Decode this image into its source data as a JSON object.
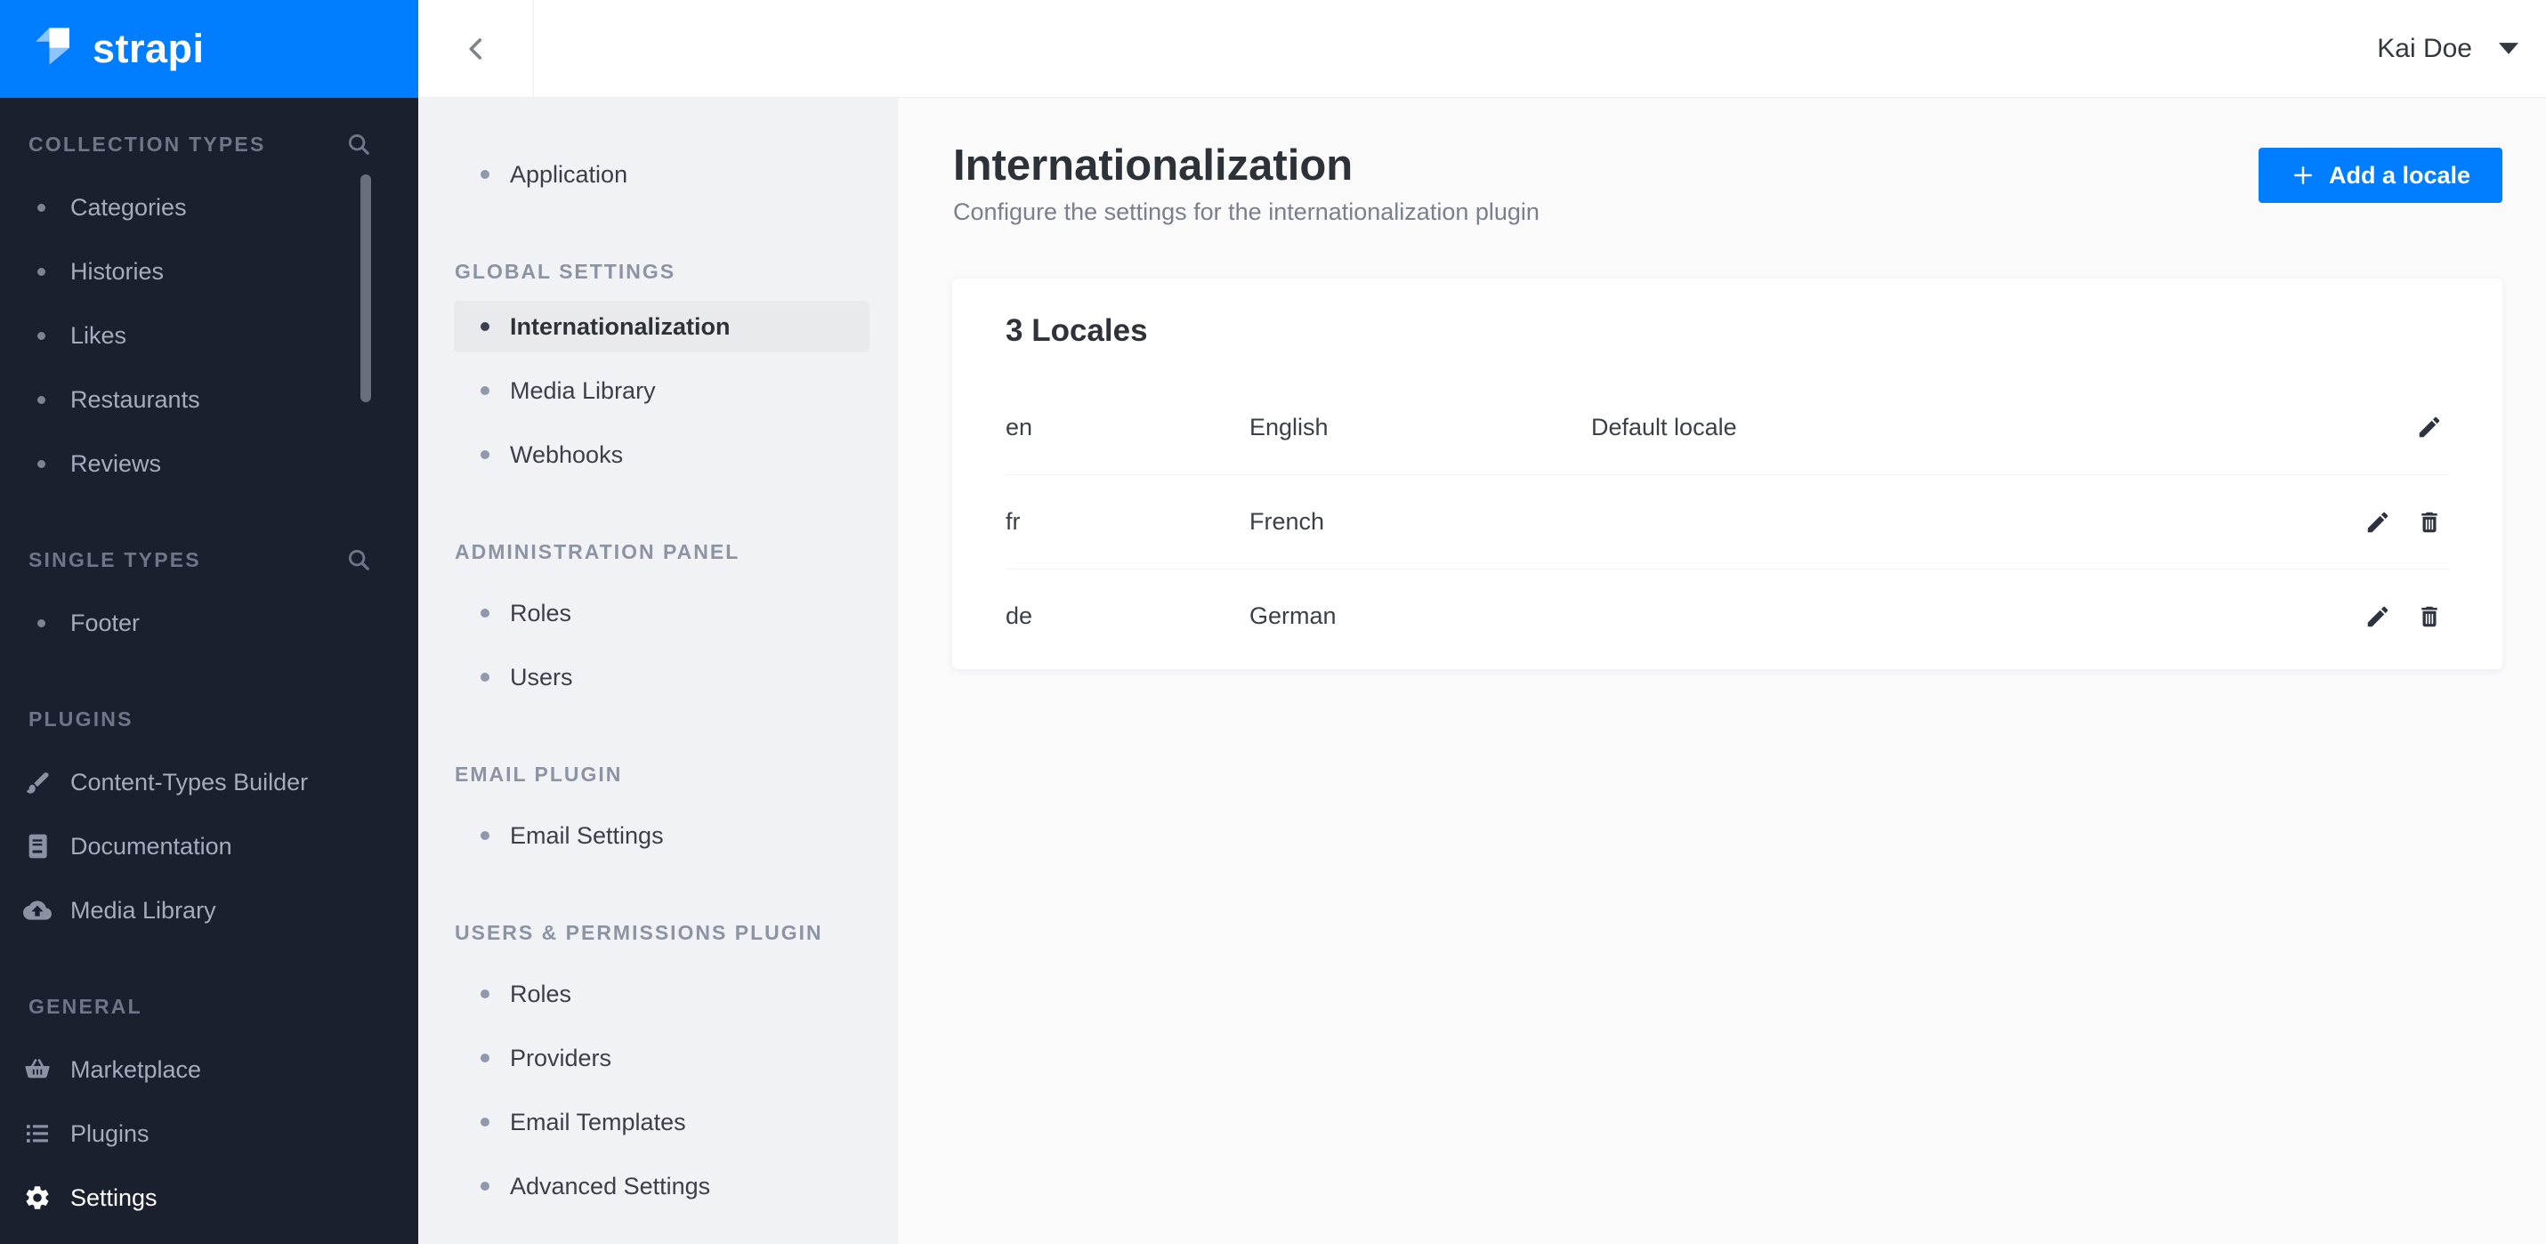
{
  "brand": {
    "name": "strapi",
    "accent_blue": "#007EFF",
    "sidebar_bg": "#1A202E"
  },
  "header": {
    "user_name": "Kai Doe",
    "back_icon": "chevron-left-icon",
    "user_caret_icon": "caret-down-icon"
  },
  "dark_sidebar": {
    "sections": [
      {
        "label": "COLLECTION TYPES",
        "search_icon": "search-icon",
        "items": [
          {
            "label": "Categories"
          },
          {
            "label": "Histories"
          },
          {
            "label": "Likes"
          },
          {
            "label": "Restaurants"
          },
          {
            "label": "Reviews"
          }
        ]
      },
      {
        "label": "SINGLE TYPES",
        "search_icon": "search-icon",
        "items": [
          {
            "label": "Footer"
          }
        ]
      },
      {
        "label": "PLUGINS",
        "items": [
          {
            "label": "Content-Types Builder",
            "icon": "brush-icon"
          },
          {
            "label": "Documentation",
            "icon": "book-icon"
          },
          {
            "label": "Media Library",
            "icon": "cloud-upload-icon"
          }
        ]
      },
      {
        "label": "GENERAL",
        "items": [
          {
            "label": "Marketplace",
            "icon": "basket-icon"
          },
          {
            "label": "Plugins",
            "icon": "list-icon"
          },
          {
            "label": "Settings",
            "icon": "gear-icon",
            "active": true
          }
        ]
      }
    ]
  },
  "settings_sidebar": {
    "application": {
      "label": "Application"
    },
    "sections": [
      {
        "label": "GLOBAL SETTINGS",
        "items": [
          {
            "label": "Internationalization",
            "active": true
          },
          {
            "label": "Media Library"
          },
          {
            "label": "Webhooks"
          }
        ]
      },
      {
        "label": "ADMINISTRATION PANEL",
        "items": [
          {
            "label": "Roles"
          },
          {
            "label": "Users"
          }
        ]
      },
      {
        "label": "EMAIL PLUGIN",
        "items": [
          {
            "label": "Email Settings"
          }
        ]
      },
      {
        "label": "USERS & PERMISSIONS PLUGIN",
        "items": [
          {
            "label": "Roles"
          },
          {
            "label": "Providers"
          },
          {
            "label": "Email Templates"
          },
          {
            "label": "Advanced Settings"
          }
        ]
      }
    ]
  },
  "main": {
    "title": "Internationalization",
    "subtitle": "Configure the settings for the internationalization plugin",
    "add_locale_button": "Add a locale",
    "locales_card": {
      "title": "3 Locales",
      "rows": [
        {
          "code": "en",
          "name": "English",
          "note": "Default locale"
        },
        {
          "code": "fr",
          "name": "French",
          "note": ""
        },
        {
          "code": "de",
          "name": "German",
          "note": ""
        }
      ]
    }
  }
}
